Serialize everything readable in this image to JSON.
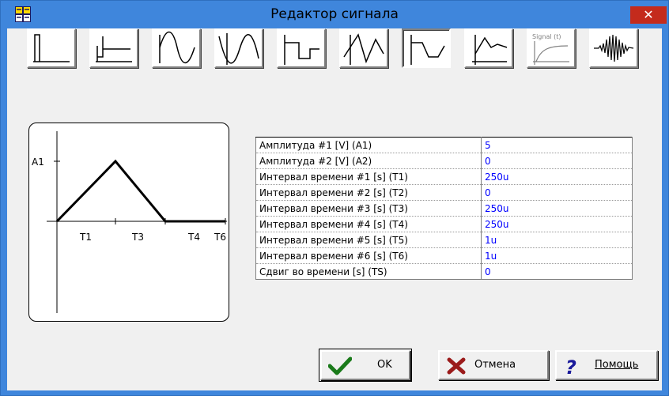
{
  "window": {
    "title": "Редактор сигнала",
    "close_label": "✕",
    "app_icon": "app-logo-icon"
  },
  "toolbar": {
    "buttons": [
      {
        "icon": "impulse-icon",
        "pressed": false
      },
      {
        "icon": "step-icon",
        "pressed": false
      },
      {
        "icon": "sine-icon",
        "pressed": false
      },
      {
        "icon": "cosine-icon",
        "pressed": false
      },
      {
        "icon": "square-wave-icon",
        "pressed": false
      },
      {
        "icon": "sawtooth-sine-icon",
        "pressed": false
      },
      {
        "icon": "trapezoid-wave-icon",
        "pressed": true
      },
      {
        "icon": "piecewise-linear-icon",
        "pressed": false
      },
      {
        "icon": "signal-t-icon",
        "pressed": false,
        "label": "Signal (t)"
      },
      {
        "icon": "modulated-burst-icon",
        "pressed": false
      }
    ]
  },
  "preview": {
    "y_label": "A1",
    "x_labels": [
      "T1",
      "T3",
      "T4",
      "T6"
    ]
  },
  "params": [
    {
      "label": "Амплитуда #1 [V] (A1)",
      "value": "5"
    },
    {
      "label": "Амплитуда #2 [V] (A2)",
      "value": "0"
    },
    {
      "label": "Интервал времени #1 [s] (T1)",
      "value": "250u"
    },
    {
      "label": "Интервал времени #2 [s] (T2)",
      "value": "0"
    },
    {
      "label": "Интервал времени #3 [s] (T3)",
      "value": "250u"
    },
    {
      "label": "Интервал времени #4 [s] (T4)",
      "value": "250u"
    },
    {
      "label": "Интервал времени #5 [s] (T5)",
      "value": "1u"
    },
    {
      "label": "Интервал времени #6 [s] (T6)",
      "value": "1u"
    },
    {
      "label": "Сдвиг во времени [s] (TS)",
      "value": "0"
    }
  ],
  "buttons": {
    "ok": {
      "label": "OK",
      "icon": "checkmark-icon"
    },
    "cancel": {
      "label": "Отмена",
      "icon": "x-cross-icon"
    },
    "help": {
      "label": "Помощь",
      "icon": "question-icon"
    }
  },
  "colors": {
    "title_bar": "#3f86dc",
    "close": "#c42b1c",
    "value_text": "#0000ff"
  }
}
